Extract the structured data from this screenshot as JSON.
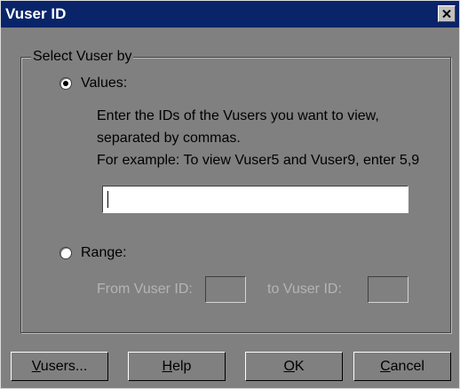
{
  "window": {
    "title": "Vuser ID"
  },
  "group": {
    "legend": "Select Vuser by"
  },
  "values_option": {
    "label": "Values:",
    "selected": true,
    "instructions": [
      "Enter the IDs of the Vusers you want to view,",
      "separated by commas.",
      "For example: To view Vuser5 and Vuser9, enter 5,9"
    ],
    "input_value": ""
  },
  "range_option": {
    "label": "Range:",
    "selected": false,
    "from_label": "From Vuser ID:",
    "from_value": "",
    "to_label": "to Vuser ID:",
    "to_value": ""
  },
  "buttons": {
    "vusers": {
      "mnemonic": "V",
      "rest": "users..."
    },
    "help": {
      "mnemonic": "H",
      "rest": "elp"
    },
    "ok": {
      "mnemonic": "O",
      "rest": "K"
    },
    "cancel": {
      "mnemonic": "C",
      "rest": "ancel"
    }
  },
  "colors": {
    "titlebar": "#0a246a",
    "dialog_bg": "#808080",
    "disabled_text": "#b4b4b4"
  },
  "icons": {
    "close": "close-icon"
  }
}
